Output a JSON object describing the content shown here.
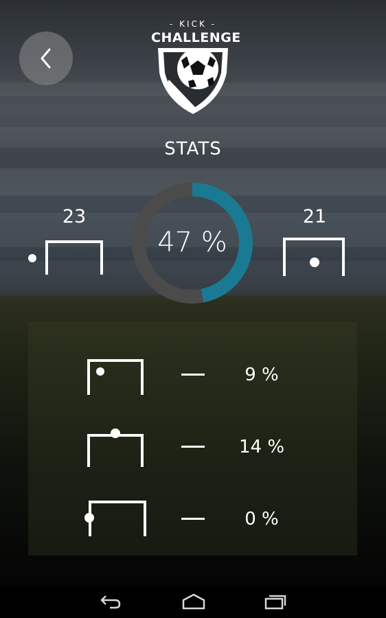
{
  "app": {
    "logo_kick": "- KICK -",
    "logo_challenge": "CHALLENGE"
  },
  "header": {
    "title": "STATS"
  },
  "summary": {
    "left_score": "23",
    "right_score": "21",
    "percentage_label": "47 %",
    "percentage_value": 0.47,
    "ring_color": "#1a7a93",
    "track_color": "#4b4b4b"
  },
  "breakdown": [
    {
      "ball_position": "top-left",
      "value": "9 %"
    },
    {
      "ball_position": "crossbar-top",
      "value": "14 %"
    },
    {
      "ball_position": "left-post",
      "value": "0 %"
    }
  ],
  "navigation": {
    "back": "back-icon",
    "home": "home-icon",
    "recents": "recents-icon"
  }
}
